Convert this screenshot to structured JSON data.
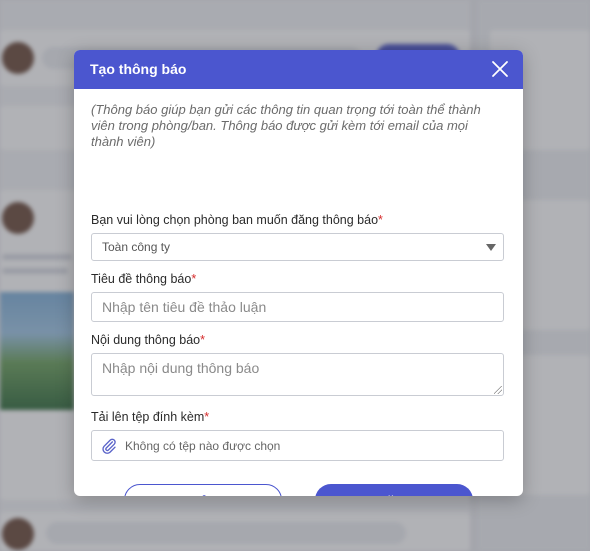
{
  "dialog": {
    "title": "Tạo thông báo",
    "hint": "(Thông báo giúp bạn gửi các thông tin quan trọng tới toàn thể thành viên trong phòng/ban. Thông báo được gửi kèm tới email của mọi thành viên)",
    "department": {
      "label": "Bạn vui lòng chọn phòng ban muốn đăng thông báo",
      "required_mark": "*",
      "selected": "Toàn công ty"
    },
    "title_field": {
      "label": "Tiêu đề thông báo",
      "required_mark": "*",
      "placeholder": "Nhập tên tiêu đề thảo luận",
      "value": ""
    },
    "content_field": {
      "label": "Nội dung thông báo",
      "required_mark": "*",
      "placeholder": "Nhập nội dung thông báo",
      "value": ""
    },
    "attachment": {
      "label": "Tải lên tệp đính kèm",
      "required_mark": "*",
      "status": "Không có tệp nào được chọn"
    },
    "buttons": {
      "cancel": "Hủy",
      "post": "Đăng"
    }
  },
  "icons": {
    "close": "close-icon",
    "dropdown": "chevron-down-icon",
    "attachment": "paperclip-icon"
  },
  "colors": {
    "accent": "#4b56cf",
    "required": "#d62b2b"
  }
}
